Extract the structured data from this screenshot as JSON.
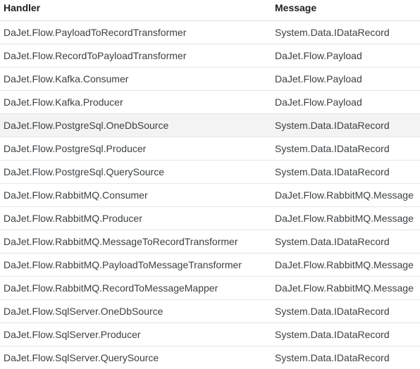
{
  "table": {
    "columns": [
      "Handler",
      "Message"
    ],
    "rows": [
      {
        "handler": "DaJet.Flow.PayloadToRecordTransformer",
        "message": "System.Data.IDataRecord",
        "highlighted": false
      },
      {
        "handler": "DaJet.Flow.RecordToPayloadTransformer",
        "message": "DaJet.Flow.Payload",
        "highlighted": false
      },
      {
        "handler": "DaJet.Flow.Kafka.Consumer",
        "message": "DaJet.Flow.Payload",
        "highlighted": false
      },
      {
        "handler": "DaJet.Flow.Kafka.Producer",
        "message": "DaJet.Flow.Payload",
        "highlighted": false
      },
      {
        "handler": "DaJet.Flow.PostgreSql.OneDbSource",
        "message": "System.Data.IDataRecord",
        "highlighted": true
      },
      {
        "handler": "DaJet.Flow.PostgreSql.Producer",
        "message": "System.Data.IDataRecord",
        "highlighted": false
      },
      {
        "handler": "DaJet.Flow.PostgreSql.QuerySource",
        "message": "System.Data.IDataRecord",
        "highlighted": false
      },
      {
        "handler": "DaJet.Flow.RabbitMQ.Consumer",
        "message": "DaJet.Flow.RabbitMQ.Message",
        "highlighted": false
      },
      {
        "handler": "DaJet.Flow.RabbitMQ.Producer",
        "message": "DaJet.Flow.RabbitMQ.Message",
        "highlighted": false
      },
      {
        "handler": "DaJet.Flow.RabbitMQ.MessageToRecordTransformer",
        "message": "System.Data.IDataRecord",
        "highlighted": false
      },
      {
        "handler": "DaJet.Flow.RabbitMQ.PayloadToMessageTransformer",
        "message": "DaJet.Flow.RabbitMQ.Message",
        "highlighted": false
      },
      {
        "handler": "DaJet.Flow.RabbitMQ.RecordToMessageMapper",
        "message": "DaJet.Flow.RabbitMQ.Message",
        "highlighted": false
      },
      {
        "handler": "DaJet.Flow.SqlServer.OneDbSource",
        "message": "System.Data.IDataRecord",
        "highlighted": false
      },
      {
        "handler": "DaJet.Flow.SqlServer.Producer",
        "message": "System.Data.IDataRecord",
        "highlighted": false
      },
      {
        "handler": "DaJet.Flow.SqlServer.QuerySource",
        "message": "System.Data.IDataRecord",
        "highlighted": false
      }
    ]
  }
}
